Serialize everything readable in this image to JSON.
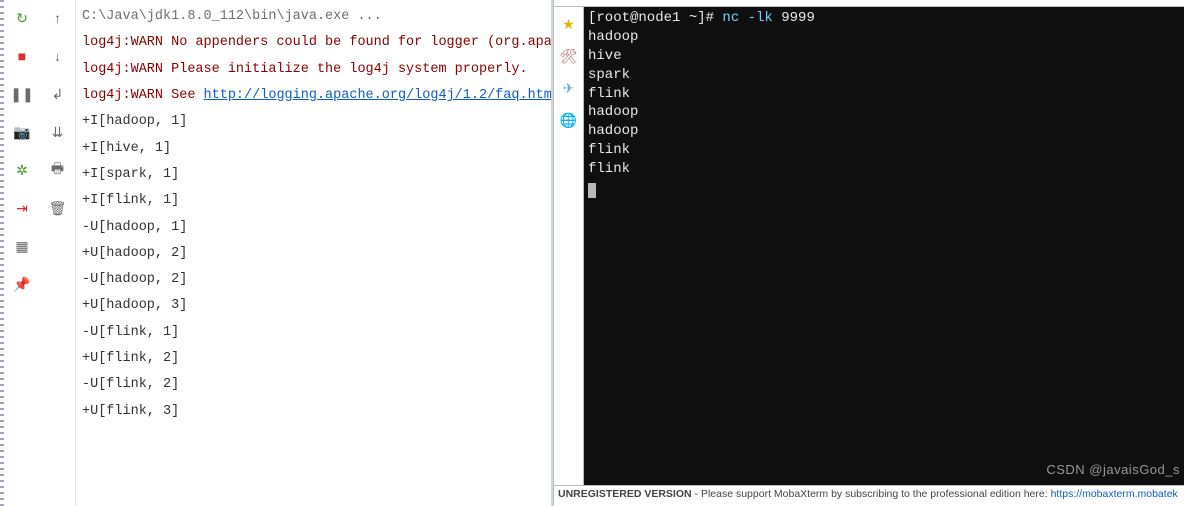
{
  "ide": {
    "tools_col1": [
      {
        "name": "rerun-icon",
        "glyph": "↻",
        "cls": "green"
      },
      {
        "name": "stop-icon",
        "glyph": "■",
        "cls": "red"
      },
      {
        "name": "pause-icon",
        "glyph": "❚❚",
        "cls": ""
      },
      {
        "name": "camera-icon",
        "glyph": "📷",
        "cls": ""
      },
      {
        "name": "bug-icon",
        "glyph": "✲",
        "cls": "green"
      },
      {
        "name": "exit-icon",
        "glyph": "⇥",
        "cls": "red"
      },
      {
        "name": "layout-icon",
        "glyph": "▦",
        "cls": ""
      },
      {
        "name": "pin-icon",
        "glyph": "📌",
        "cls": ""
      }
    ],
    "tools_col2": [
      {
        "name": "up-arrow-icon",
        "glyph": "↑",
        "cls": ""
      },
      {
        "name": "down-arrow-icon",
        "glyph": "↓",
        "cls": ""
      },
      {
        "name": "soft-wrap-icon",
        "glyph": "↲",
        "cls": ""
      },
      {
        "name": "scroll-end-icon",
        "glyph": "⇊",
        "cls": ""
      },
      {
        "name": "print-icon",
        "glyph": "🖶",
        "cls": ""
      },
      {
        "name": "trash-icon",
        "glyph": "🗑",
        "cls": ""
      }
    ],
    "console": {
      "cmdline": "C:\\Java\\jdk1.8.0_112\\bin\\java.exe ...",
      "warn1": "log4j:WARN No appenders could be found for logger (org.apa",
      "warn2": "log4j:WARN Please initialize the log4j system properly.",
      "warn3_prefix": "log4j:WARN See ",
      "warn3_link": "http://logging.apache.org/log4j/1.2/faq.htm",
      "output": [
        "+I[hadoop, 1]",
        "+I[hive, 1]",
        "+I[spark, 1]",
        "+I[flink, 1]",
        "-U[hadoop, 1]",
        "+U[hadoop, 2]",
        "-U[hadoop, 2]",
        "+U[hadoop, 3]",
        "-U[flink, 1]",
        "+U[flink, 2]",
        "-U[flink, 2]",
        "+U[flink, 3]"
      ]
    }
  },
  "moba": {
    "sidebar": [
      {
        "name": "star-icon",
        "glyph": "★",
        "color": "#e8b800"
      },
      {
        "name": "tools-icon",
        "glyph": "🛠",
        "color": "#c06060"
      },
      {
        "name": "send-icon",
        "glyph": "✈",
        "color": "#6aa8e6"
      },
      {
        "name": "globe-icon",
        "glyph": "🌐",
        "color": "#e0a030"
      }
    ],
    "terminal": {
      "prompt_user": "[root@node1 ~]# ",
      "prompt_cmd": "nc -lk",
      "prompt_arg": " 9999",
      "lines": [
        "hadoop",
        "hive",
        "spark",
        "flink",
        "hadoop",
        "hadoop",
        "flink",
        "flink"
      ]
    },
    "footer_bold": "UNREGISTERED VERSION",
    "footer_text": " - Please support MobaXterm by subscribing to the professional edition here: ",
    "footer_link": "https://mobaxterm.mobatek",
    "watermark": "CSDN @javaisGod_s"
  }
}
